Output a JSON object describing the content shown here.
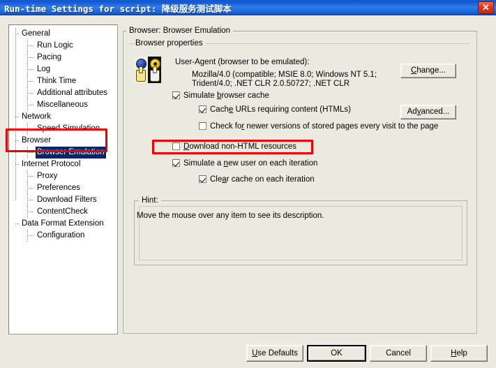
{
  "window": {
    "title": "Run-time Settings for script: 降级服务测试脚本",
    "close_icon": "close-x-icon",
    "close_label": "✕"
  },
  "tree": {
    "items": [
      {
        "label": "General",
        "level": 0,
        "selected": false
      },
      {
        "label": "Run Logic",
        "level": 1,
        "selected": false
      },
      {
        "label": "Pacing",
        "level": 1,
        "selected": false
      },
      {
        "label": "Log",
        "level": 1,
        "selected": false
      },
      {
        "label": "Think Time",
        "level": 1,
        "selected": false
      },
      {
        "label": "Additional attributes",
        "level": 1,
        "selected": false
      },
      {
        "label": "Miscellaneous",
        "level": 1,
        "selected": false
      },
      {
        "label": "Network",
        "level": 0,
        "selected": false
      },
      {
        "label": "Speed Simulation",
        "level": 1,
        "selected": false
      },
      {
        "label": "Browser",
        "level": 0,
        "selected": false
      },
      {
        "label": "Browser Emulation",
        "level": 1,
        "selected": true
      },
      {
        "label": "Internet Protocol",
        "level": 0,
        "selected": false
      },
      {
        "label": "Proxy",
        "level": 1,
        "selected": false
      },
      {
        "label": "Preferences",
        "level": 1,
        "selected": false
      },
      {
        "label": "Download Filters",
        "level": 1,
        "selected": false
      },
      {
        "label": "ContentCheck",
        "level": 1,
        "selected": false
      },
      {
        "label": "Data Format Extension",
        "level": 0,
        "selected": false
      },
      {
        "label": "Configuration",
        "level": 1,
        "selected": false
      }
    ]
  },
  "content": {
    "group_title": "Browser: Browser Emulation",
    "properties_label": "Browser properties",
    "ua_icon": "browser-hand-icon",
    "ua_title": "User-Agent (browser to be emulated):",
    "ua_value": "Mozilla/4.0 (compatible; MSIE 8.0; Windows NT 5.1;\nTrident/4.0; .NET CLR 2.0.50727; .NET CLR",
    "change_button": "Change...",
    "advanced_button": "Advanced...",
    "checkboxes": [
      {
        "id": "simulate-browser-cache",
        "label": "Simulate browser cache",
        "checked": true
      },
      {
        "id": "cache-urls-requiring-content",
        "label": "Cache URLs requiring content (HTMLs)",
        "checked": true
      },
      {
        "id": "check-for-newer-versions",
        "label": "Check for newer versions of stored pages every visit to the page",
        "checked": false
      },
      {
        "id": "download-non-html-resources",
        "label": "Download non-HTML resources",
        "checked": false
      },
      {
        "id": "simulate-new-user-each-iteration",
        "label": "Simulate a new user on each iteration",
        "checked": true
      },
      {
        "id": "clear-cache-each-iteration",
        "label": "Clear cache on each iteration",
        "checked": true
      }
    ],
    "hint_legend": "Hint:",
    "hint_text": "Move the mouse over any item to see its description."
  },
  "footer": {
    "use_defaults": "Use Defaults",
    "ok": "OK",
    "cancel": "Cancel",
    "help": "Help"
  },
  "annotations": {
    "highlight_color": "#ee0000",
    "boxes": [
      "browser-emulation-tree-node",
      "download-non-html-resources-row"
    ]
  }
}
